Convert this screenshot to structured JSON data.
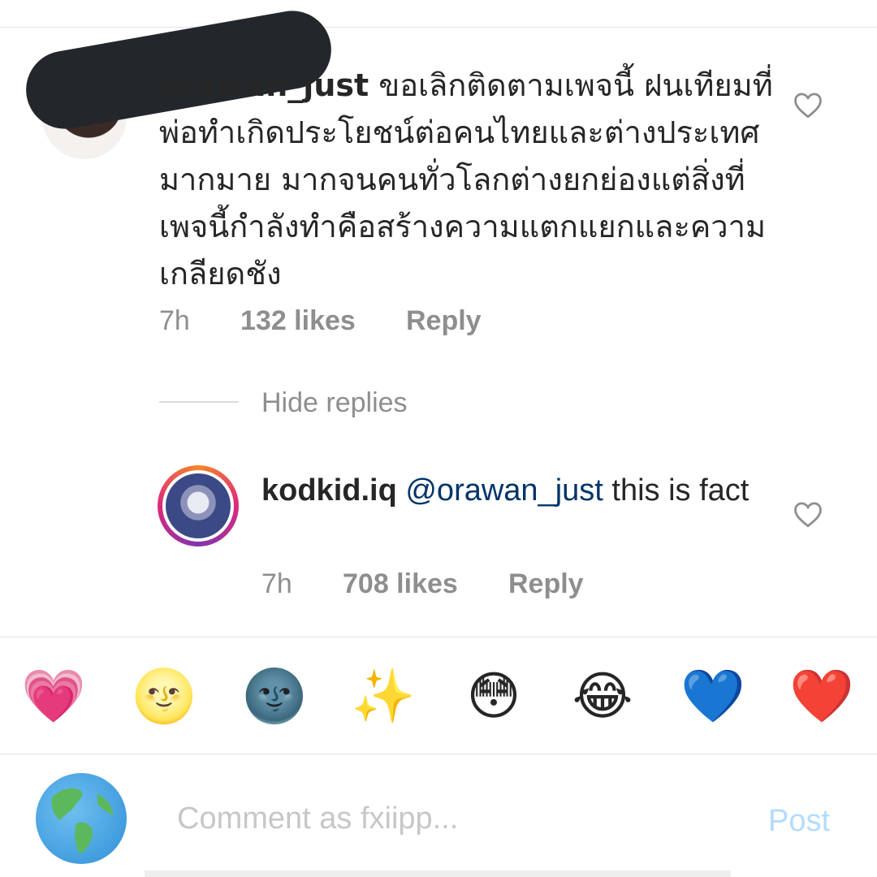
{
  "main_comment": {
    "username": "orawan_just",
    "text": "ขอเลิกติดตามเพจนี้ ฝนเทียมที่พ่อทำเกิดประโยชน์ต่อคนไทยและต่างประเทศมากมาย  มากจนคนทั่วโลกต่างยกย่องแต่สิ่งที่เพจนี้กำลังทำคือสร้างความแตกแยกและความเกลียดชัง",
    "time": "7h",
    "likes": "132 likes",
    "reply_label": "Reply"
  },
  "thread": {
    "hide_replies_label": "Hide replies"
  },
  "reply": {
    "username": "kodkid.iq",
    "mention": "@orawan_just",
    "text": "this is fact",
    "time": "7h",
    "likes": "708 likes",
    "reply_label": "Reply"
  },
  "emoji_bar": [
    "💗",
    "🌝",
    "🌚",
    "✨",
    "😳",
    "😂",
    "💙",
    "❤️"
  ],
  "composer": {
    "placeholder": "Comment as fxiipp...",
    "post_label": "Post",
    "avatar_icon": "globe-americas-icon"
  },
  "colors": {
    "text": "#262626",
    "muted": "#8e8e8e",
    "mention": "#003569",
    "post_disabled": "#b3dbff",
    "divider": "#e4e4e4"
  }
}
